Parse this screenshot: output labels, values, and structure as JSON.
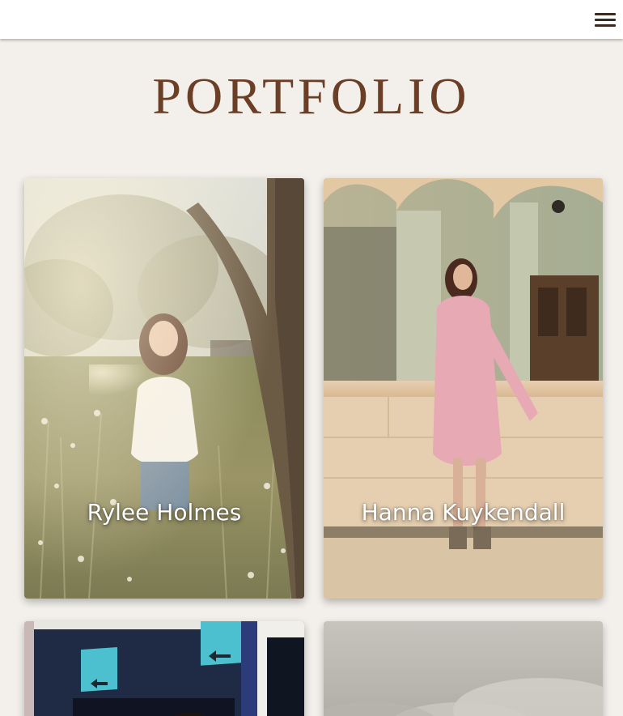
{
  "header": {
    "menu_icon": "hamburger-menu-icon"
  },
  "page": {
    "title": "PORTFOLIO"
  },
  "portfolio": {
    "items": [
      {
        "name": "Rylee Holmes"
      },
      {
        "name": "Hanna Kuykendall"
      },
      {
        "name": ""
      },
      {
        "name": ""
      }
    ]
  },
  "colors": {
    "title": "#6b3f26",
    "background": "#f3f0ec",
    "header": "#ffffff"
  }
}
